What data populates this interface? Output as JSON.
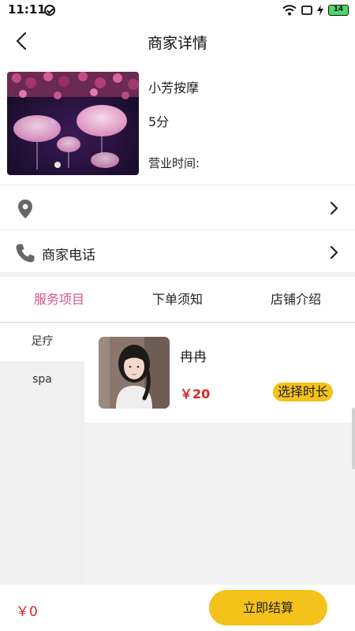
{
  "status_bar": {
    "time": "11:11",
    "battery": "14"
  },
  "header": {
    "title": "商家详情",
    "back_icon": "chevron-left-icon"
  },
  "shop": {
    "name": "小芳按摩",
    "score": "5分",
    "hours_label": "营业时间:"
  },
  "address_row": {
    "icon": "location-pin-icon",
    "text": ""
  },
  "phone_row": {
    "icon": "phone-icon",
    "label": "商家电话"
  },
  "tabs": [
    {
      "label": "服务项目",
      "active": true
    },
    {
      "label": "下单须知",
      "active": false
    },
    {
      "label": "店铺介绍",
      "active": false
    }
  ],
  "categories": [
    {
      "label": "足疗",
      "active": true
    },
    {
      "label": "spa",
      "active": false
    }
  ],
  "services": [
    {
      "name": "冉冉",
      "price": "￥20",
      "choose_label": "选择时长"
    }
  ],
  "bottom": {
    "total": "￥0",
    "checkout_label": "立即结算"
  },
  "colors": {
    "accent_pink": "#d9538a",
    "accent_yellow": "#f5c21b",
    "price_red": "#d9262a"
  }
}
